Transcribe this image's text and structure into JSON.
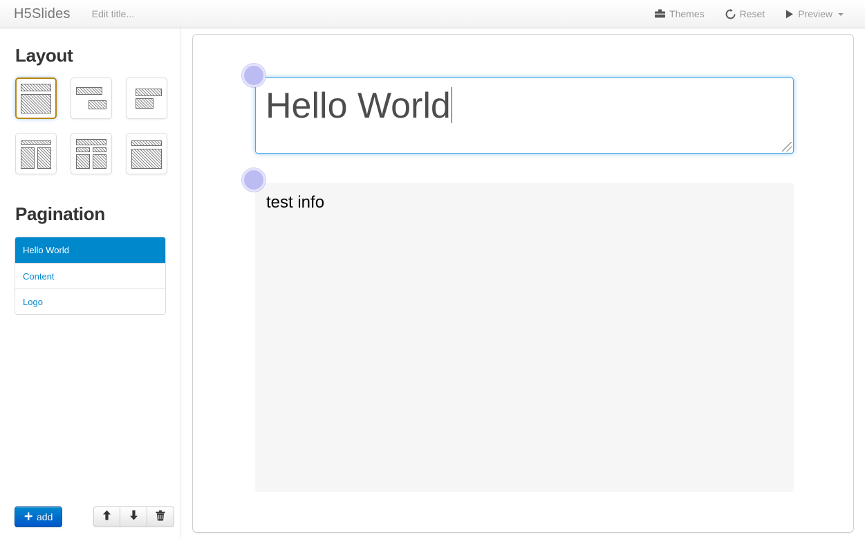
{
  "navbar": {
    "brand": "H5Slides",
    "title_placeholder": "Edit title...",
    "links": [
      {
        "label": "Themes",
        "icon": "briefcase-icon"
      },
      {
        "label": "Reset",
        "icon": "refresh-icon"
      },
      {
        "label": "Preview",
        "icon": "play-icon",
        "has_caret": true
      }
    ]
  },
  "sidebar": {
    "layout_title": "Layout",
    "pagination_title": "Pagination",
    "layouts": [
      {
        "name": "title-and-body",
        "selected": true
      },
      {
        "name": "two-stacked-bars",
        "selected": false
      },
      {
        "name": "offset-stacked-bars",
        "selected": false
      },
      {
        "name": "header-two-columns",
        "selected": false
      },
      {
        "name": "header-subheads-two-columns",
        "selected": false
      },
      {
        "name": "header-full-body",
        "selected": false
      }
    ],
    "pagination": [
      {
        "label": "Hello World",
        "active": true
      },
      {
        "label": "Content",
        "active": false
      },
      {
        "label": "Logo",
        "active": false
      }
    ],
    "footer": {
      "add_label": "add",
      "add_icon": "plus-icon",
      "move_up_icon": "arrow-up-icon",
      "move_down_icon": "arrow-down-icon",
      "delete_icon": "trash-icon"
    }
  },
  "slide": {
    "title_value": "Hello World",
    "content_value": "test info"
  },
  "colors": {
    "accent_blue": "#0088cc",
    "focus_blue": "#4aa8e8",
    "selected_layout_border": "#b8860b",
    "handle_purple": "#bcbcf3",
    "content_bg": "#f6f6f6"
  }
}
